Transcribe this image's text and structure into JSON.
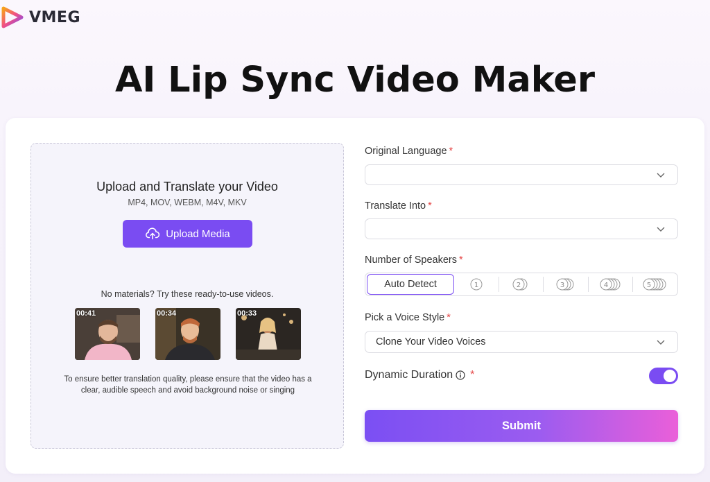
{
  "brand": {
    "name": "VMEG"
  },
  "page": {
    "title": "AI Lip Sync Video Maker"
  },
  "upload": {
    "title": "Upload and Translate your Video",
    "formats": "MP4, MOV, WEBM, M4V, MKV",
    "button_label": "Upload Media",
    "samples_caption": "No materials? Try these ready-to-use videos.",
    "samples": [
      {
        "duration": "00:41"
      },
      {
        "duration": "00:34"
      },
      {
        "duration": "00:33"
      }
    ],
    "note": "To ensure better translation quality, please ensure that the video has a clear, audible speech and avoid background noise or singing"
  },
  "form": {
    "original_language": {
      "label": "Original Language",
      "required": "*",
      "value": ""
    },
    "translate_into": {
      "label": "Translate Into",
      "required": "*",
      "value": ""
    },
    "speakers": {
      "label": "Number of Speakers",
      "required": "*",
      "auto_label": "Auto Detect",
      "options": [
        "1",
        "2",
        "3",
        "4",
        "5"
      ]
    },
    "voice_style": {
      "label": "Pick a Voice Style",
      "required": "*",
      "value": "Clone Your Video Voices"
    },
    "dynamic_duration": {
      "label": "Dynamic Duration",
      "required": "*",
      "enabled": true
    },
    "submit_label": "Submit"
  },
  "colors": {
    "accent": "#7a4cf2",
    "gradient_end": "#ea5fd9",
    "required": "#e54545"
  }
}
